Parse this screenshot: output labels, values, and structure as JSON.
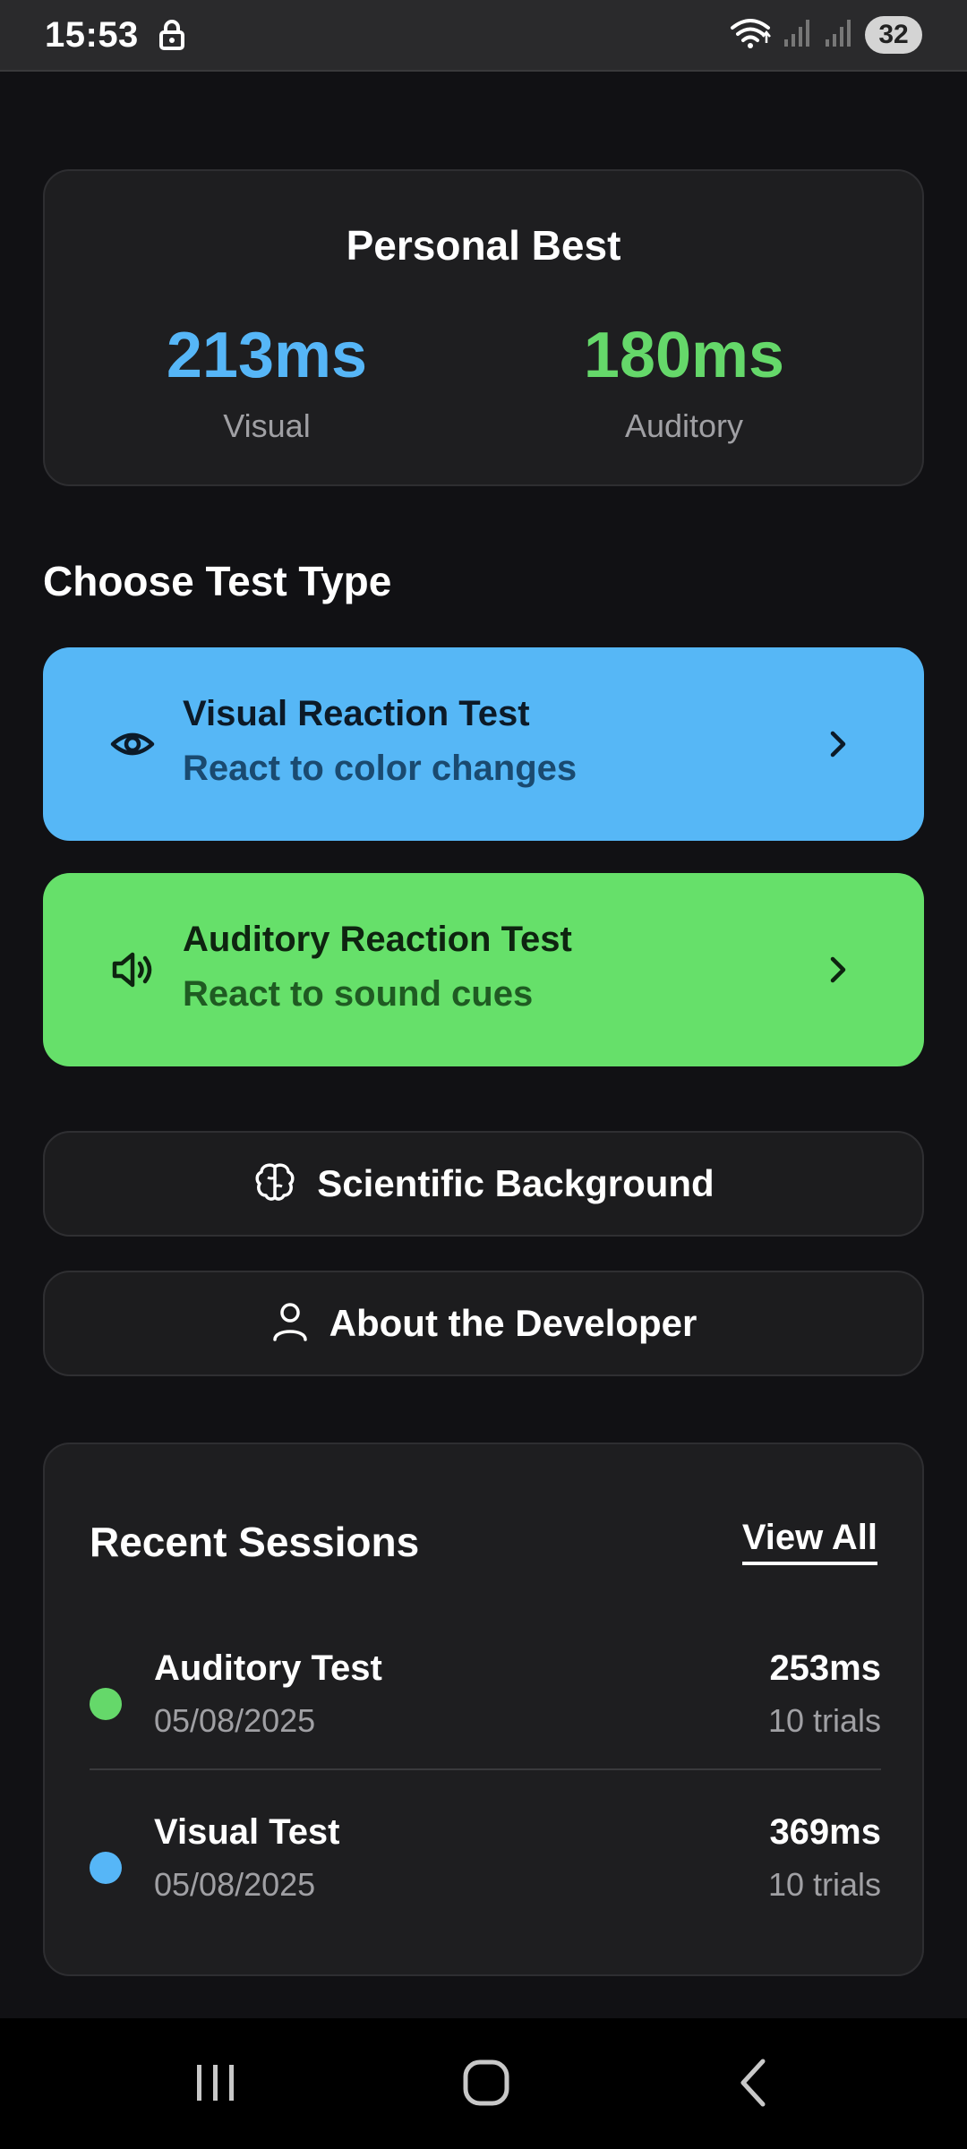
{
  "status_bar": {
    "time": "15:53",
    "battery": "32"
  },
  "personal_best": {
    "title": "Personal Best",
    "visual": {
      "value": "213ms",
      "label": "Visual",
      "color": "#56b6f7"
    },
    "auditory": {
      "value": "180ms",
      "label": "Auditory",
      "color": "#65d86a"
    }
  },
  "choose": {
    "title": "Choose Test Type",
    "visual": {
      "title": "Visual Reaction Test",
      "subtitle": "React to color changes",
      "color": "#56b7f6"
    },
    "auditory": {
      "title": "Auditory Reaction Test",
      "subtitle": "React to sound cues",
      "color": "#66e06a"
    }
  },
  "buttons": {
    "scientific": "Scientific Background",
    "developer": "About the Developer"
  },
  "recent": {
    "title": "Recent Sessions",
    "view_all": "View All",
    "items": [
      {
        "name": "Auditory Test",
        "date": "05/08/2025",
        "ms": "253ms",
        "trials": "10 trials",
        "color": "#65d86a"
      },
      {
        "name": "Visual Test",
        "date": "05/08/2025",
        "ms": "369ms",
        "trials": "10 trials",
        "color": "#56b6f7"
      }
    ]
  },
  "icons": {
    "lock": "lock-icon",
    "wifi": "wifi-icon",
    "signal": "signal-icon",
    "eye": "eye-icon",
    "speaker": "speaker-icon",
    "brain": "brain-icon",
    "user": "user-icon",
    "chevron": "chevron-right-icon"
  }
}
